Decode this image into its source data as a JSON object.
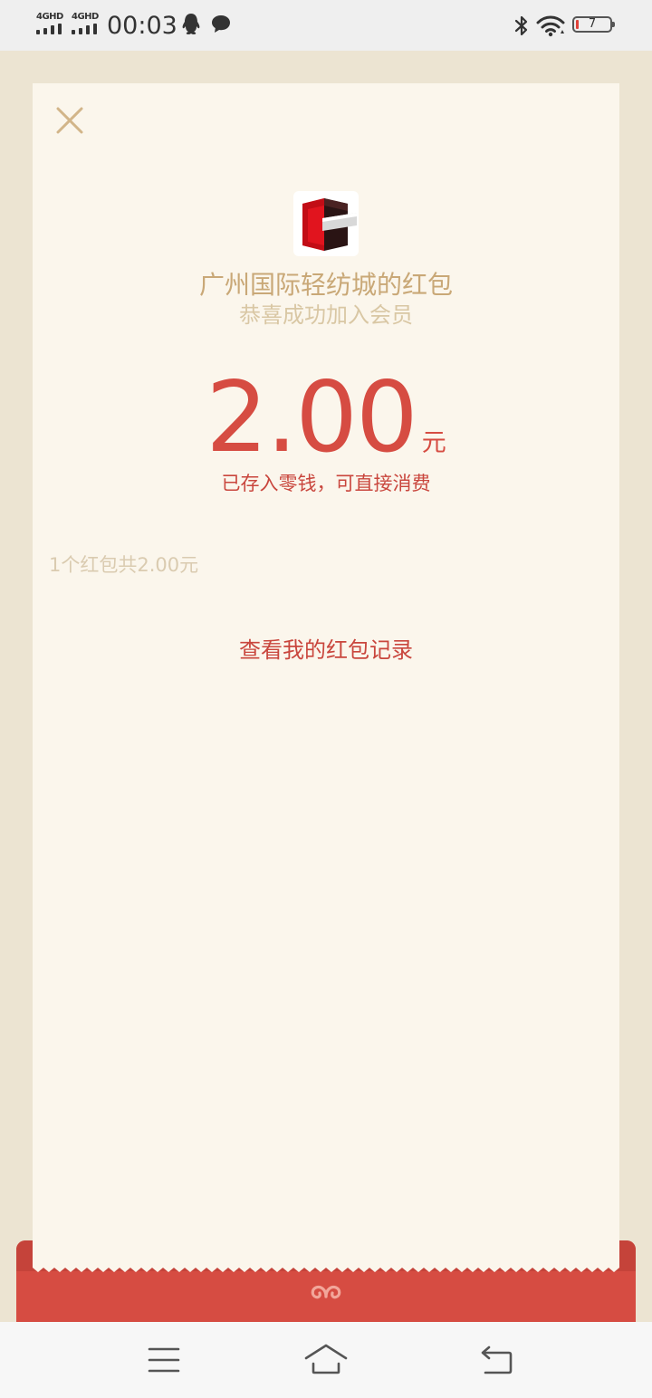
{
  "status_bar": {
    "sim1_network": "4GHD",
    "sim2_network": "4GHD",
    "time": "00:03",
    "notification_icons": [
      "qq-icon",
      "chat-bubble-icon"
    ],
    "right_icons": [
      "bluetooth-icon",
      "wifi-icon"
    ],
    "battery_level": "7"
  },
  "card": {
    "close_icon": "close-icon",
    "shop_logo": "shop-logo",
    "shop_name": "广州国际轻纺城的红包",
    "subtitle": "恭喜成功加入会员",
    "amount": "2.00",
    "unit": "元",
    "stored_note": "已存入零钱，可直接消费",
    "count_summary": "1个红包共2.00元",
    "history_link": "查看我的红包记录"
  },
  "envelope": {
    "emblem_icon": "cloud-emblem-icon"
  },
  "colors": {
    "accent_red": "#d64c42",
    "gold_text": "#c9a877",
    "card_background": "#fbf6ec",
    "page_background": "#ece4d2"
  },
  "nav_bar": {
    "icons": [
      "menu-icon",
      "home-icon",
      "back-icon"
    ]
  }
}
